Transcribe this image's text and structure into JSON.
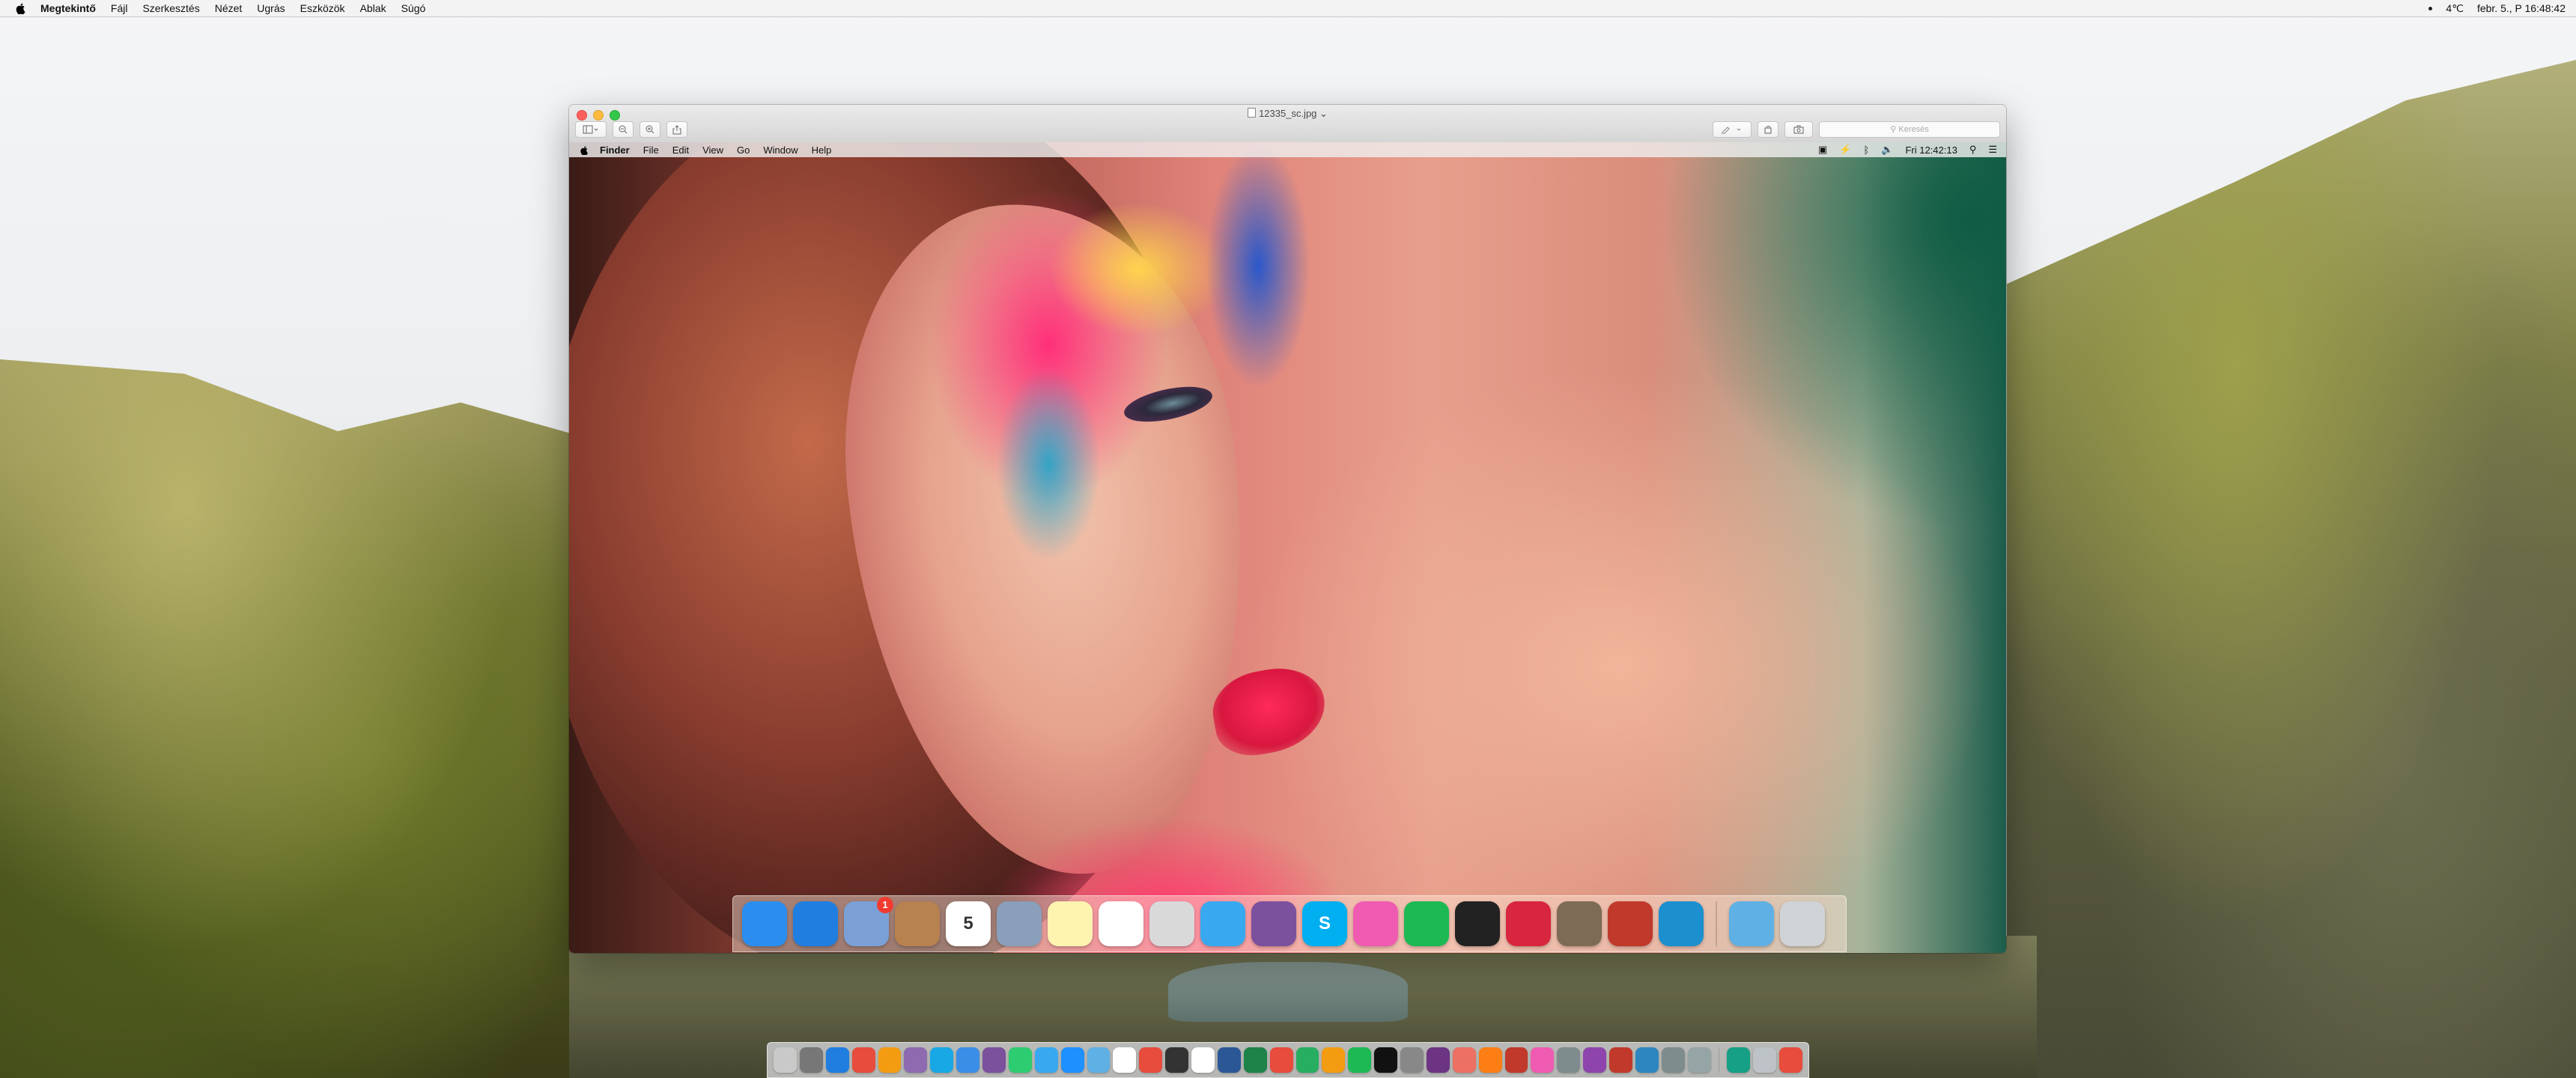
{
  "menubar": {
    "app": "Megtekintő",
    "items": [
      "Fájl",
      "Szerkesztés",
      "Nézet",
      "Ugrás",
      "Eszközök",
      "Ablak",
      "Súgó"
    ],
    "weather": "4℃",
    "datetime": "febr. 5., P 16:48:42"
  },
  "window": {
    "title": "12335_sc.jpg",
    "search_placeholder": "Keresés"
  },
  "inner_menubar": {
    "app": "Finder",
    "items": [
      "File",
      "Edit",
      "View",
      "Go",
      "Window",
      "Help"
    ],
    "clock": "Fri 12:42:13"
  },
  "inner_dock": {
    "apps": [
      {
        "icon": "finder-icon",
        "color": "#2a8ef0"
      },
      {
        "icon": "safari-icon",
        "color": "#1f7ee0"
      },
      {
        "icon": "photos-stamp-icon",
        "color": "#7aa0d6",
        "badge": "1"
      },
      {
        "icon": "contacts-icon",
        "color": "#b78150"
      },
      {
        "icon": "calendar-icon",
        "color": "#ffffff",
        "text": "5"
      },
      {
        "icon": "preview-icon",
        "color": "#8a9fb9"
      },
      {
        "icon": "notes-icon",
        "color": "#fff3b0"
      },
      {
        "icon": "reminders-icon",
        "color": "#ffffff"
      },
      {
        "icon": "system-icon",
        "color": "#d9d9d9"
      },
      {
        "icon": "messages-icon",
        "color": "#38a9f0"
      },
      {
        "icon": "viber-icon",
        "color": "#7b519d"
      },
      {
        "icon": "skype-icon",
        "color": "#00aff0",
        "text": "S"
      },
      {
        "icon": "itunes-icon",
        "color": "#f05bb2"
      },
      {
        "icon": "spotify-icon",
        "color": "#1db954"
      },
      {
        "icon": "terminal-icon",
        "color": "#222222"
      },
      {
        "icon": "parallels-icon",
        "color": "#d7263d"
      },
      {
        "icon": "archive-icon",
        "color": "#7d6b55"
      },
      {
        "icon": "box-icon",
        "color": "#c0392b"
      },
      {
        "icon": "network-icon",
        "color": "#1c8fcf"
      },
      {
        "icon": "downloads-icon",
        "color": "#5fb0e5"
      },
      {
        "icon": "trash-icon",
        "color": "#d0d3d6"
      }
    ]
  },
  "dock": {
    "colors": [
      "#c9c9c9",
      "#777777",
      "#1f7ee0",
      "#e74c3c",
      "#f39c12",
      "#8e6bb0",
      "#19a8e6",
      "#3a8ee6",
      "#7b519d",
      "#2ecc71",
      "#38a9f0",
      "#1e90ff",
      "#5fb0e5",
      "#ffffff",
      "#e74c3c",
      "#333333",
      "#ffffff",
      "#2b5797",
      "#1d8348",
      "#e74c3c",
      "#27ae60",
      "#f39c12",
      "#1db954",
      "#111111",
      "#888888",
      "#6c3483",
      "#ec7063",
      "#fd7e14",
      "#c0392b",
      "#f05bb2",
      "#7f8c8d",
      "#8e44ad",
      "#c0392b",
      "#2e86c1",
      "#7f8c8d",
      "#95a5a6",
      "#16a085",
      "#bdc3c7",
      "#e74c3c"
    ]
  }
}
